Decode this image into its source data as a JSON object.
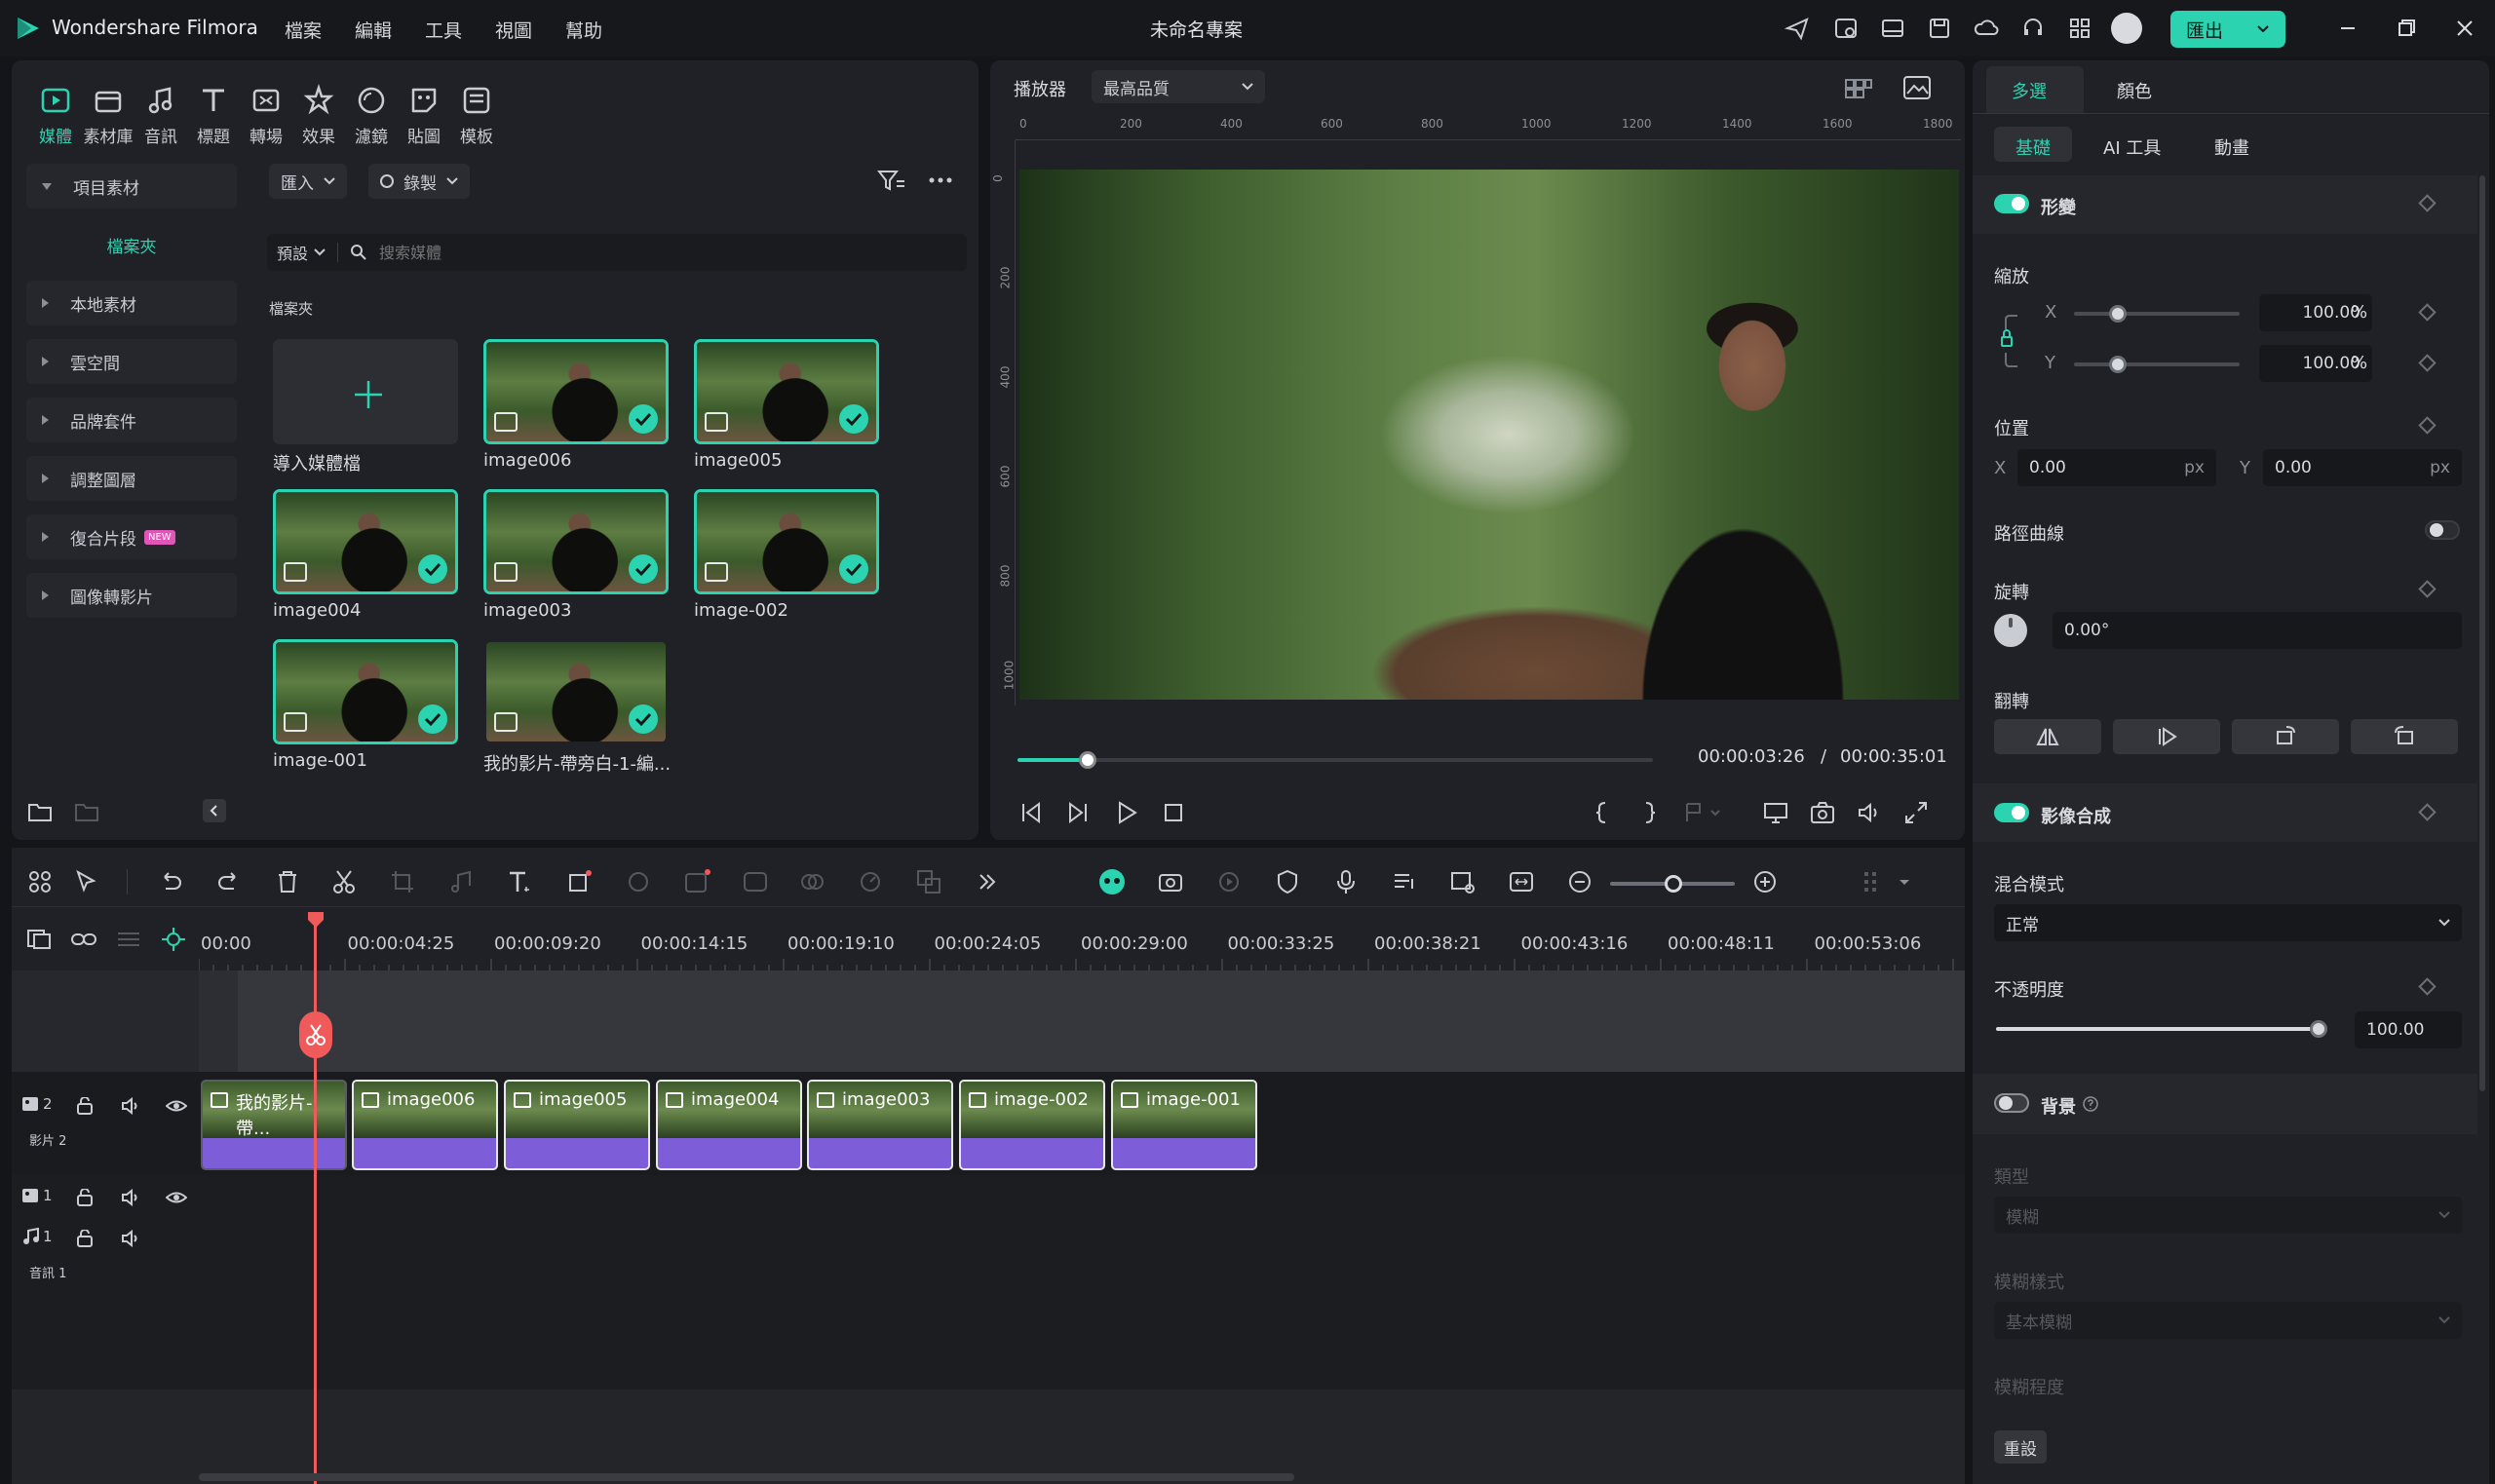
{
  "app": {
    "name": "Wondershare Filmora",
    "project_title": "未命名專案",
    "export_label": "匯出"
  },
  "menu": [
    "檔案",
    "編輯",
    "工具",
    "視圖",
    "幫助"
  ],
  "media_tabs": [
    {
      "label": "媒體",
      "icon": "media-icon"
    },
    {
      "label": "素材庫",
      "icon": "stock-icon"
    },
    {
      "label": "音訊",
      "icon": "music-icon"
    },
    {
      "label": "標題",
      "icon": "title-icon"
    },
    {
      "label": "轉場",
      "icon": "transition-icon"
    },
    {
      "label": "效果",
      "icon": "effects-icon"
    },
    {
      "label": "濾鏡",
      "icon": "filter-icon"
    },
    {
      "label": "貼圖",
      "icon": "sticker-icon"
    },
    {
      "label": "模板",
      "icon": "template-icon"
    }
  ],
  "sidebar": {
    "project_media": "項目素材",
    "folder": "檔案夾",
    "items": [
      "本地素材",
      "雲空間",
      "品牌套件",
      "調整圖層",
      "復合片段",
      "圖像轉影片"
    ],
    "new_badge": "NEW"
  },
  "toolbar": {
    "import": "匯入",
    "record": "錄製",
    "preset": "預設",
    "search_placeholder": "搜索媒體",
    "folder_heading": "檔案夾"
  },
  "media_items": [
    {
      "name": "導入媒體檔",
      "type": "import"
    },
    {
      "name": "image006",
      "selected": true
    },
    {
      "name": "image005",
      "selected": true
    },
    {
      "name": "image004",
      "selected": true
    },
    {
      "name": "image003",
      "selected": true
    },
    {
      "name": "image-002",
      "selected": true
    },
    {
      "name": "image-001",
      "selected": true
    },
    {
      "name": "我的影片-帶旁白-1-編...",
      "selected": false
    }
  ],
  "player": {
    "label": "播放器",
    "quality": "最高品質",
    "ruler_h": [
      "0",
      "200",
      "400",
      "600",
      "800",
      "1000",
      "1200",
      "1400",
      "1600",
      "1800"
    ],
    "ruler_v": [
      "0",
      "200",
      "400",
      "600",
      "800",
      "1000"
    ],
    "current_time": "00:00:03:26",
    "separator": "/",
    "total_time": "00:00:35:01",
    "progress": 0.11
  },
  "props": {
    "tabs": [
      "多選",
      "顏色"
    ],
    "subtabs": [
      "基礎",
      "AI 工具",
      "動畫"
    ],
    "transform": "形變",
    "scale": "縮放",
    "scale_x": "100.00",
    "scale_y": "100.00",
    "percent": "%",
    "x": "X",
    "y": "Y",
    "position": "位置",
    "pos_x": "0.00",
    "pos_y": "0.00",
    "px": "px",
    "path_curve": "路徑曲線",
    "rotate": "旋轉",
    "rotate_value": "0.00°",
    "flip": "翻轉",
    "compositing": "影像合成",
    "blend_mode": "混合模式",
    "blend_value": "正常",
    "opacity": "不透明度",
    "opacity_value": "100.00",
    "background": "背景",
    "type": "類型",
    "type_value": "模糊",
    "blur_style": "模糊樣式",
    "blur_style_value": "基本模糊",
    "blur_level": "模糊程度",
    "reset": "重設"
  },
  "timeline": {
    "ticks": [
      "00:00",
      "00:00:04:25",
      "00:00:09:20",
      "00:00:14:15",
      "00:00:19:10",
      "00:00:24:05",
      "00:00:29:00",
      "00:00:33:25",
      "00:00:38:21",
      "00:00:43:16",
      "00:00:48:11",
      "00:00:53:06"
    ],
    "clips": [
      "我的影片-帶...",
      "image006",
      "image005",
      "image004",
      "image003",
      "image-002",
      "image-001"
    ],
    "track_video2": "2",
    "track_video2_name": "影片 2",
    "track_video1": "1",
    "track_audio1": "1",
    "track_audio1_name": "音訊 1"
  },
  "colors": {
    "accent": "#2bd3b0",
    "playhead": "#f05a5a",
    "clip": "#7e5dd8"
  }
}
